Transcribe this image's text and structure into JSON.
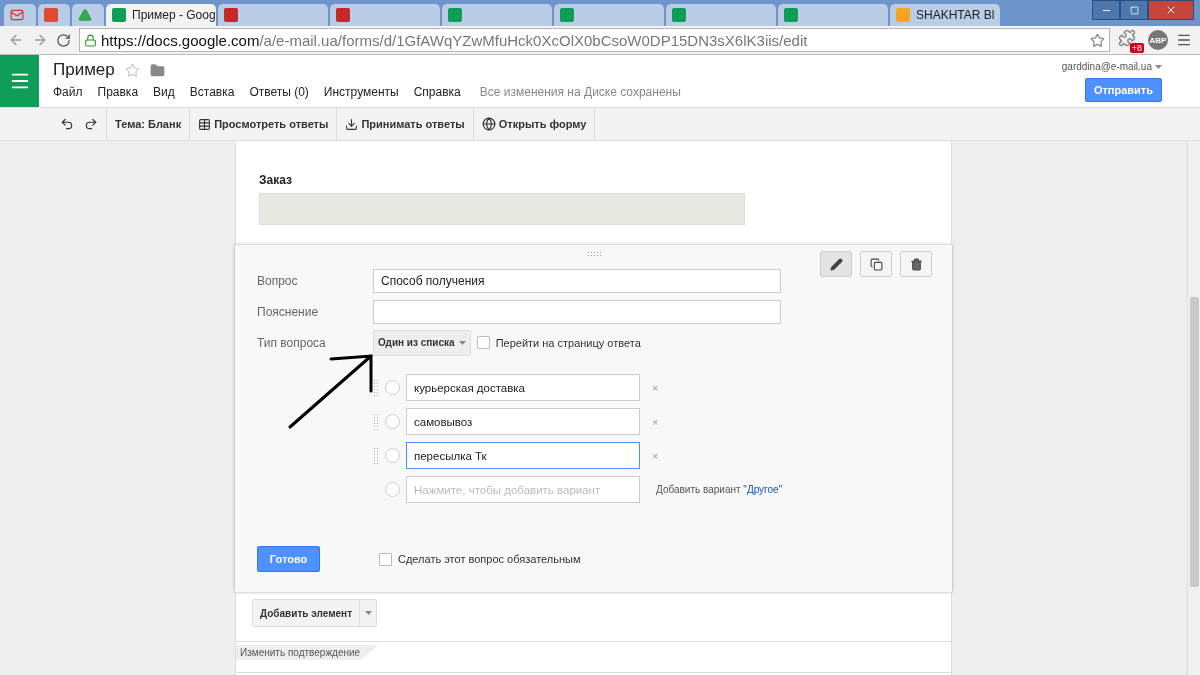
{
  "browser": {
    "tabs": [
      {
        "kind": "gmail",
        "selected": false,
        "color": "#d93025"
      },
      {
        "kind": "app",
        "selected": false,
        "color": "#e04a2f"
      },
      {
        "kind": "drive",
        "selected": false,
        "color": "#34a853"
      },
      {
        "kind": "forms",
        "title": "Пример - Goog",
        "selected": true,
        "color": "#0f9d58"
      },
      {
        "kind": "app",
        "selected": false,
        "color": "#c62828"
      },
      {
        "kind": "app",
        "selected": false,
        "color": "#c62828"
      },
      {
        "kind": "forms",
        "selected": false,
        "color": "#0f9d58"
      },
      {
        "kind": "forms",
        "selected": false,
        "color": "#0f9d58"
      },
      {
        "kind": "forms",
        "selected": false,
        "color": "#0f9d58"
      },
      {
        "kind": "forms",
        "selected": false,
        "color": "#0f9d58"
      },
      {
        "kind": "app",
        "title": "SHAKHTAR Bl",
        "selected": false,
        "color": "#f5a623"
      }
    ],
    "url": {
      "host": "https://docs.google.com",
      "path": "/a/e-mail.ua/forms/d/1GfAWqYZwMfuHck0XcOlX0bCsoW0DP15DN3sX6lK3iis/edit"
    },
    "extension_badge": "+8",
    "extension_label": "ABP"
  },
  "doc": {
    "title": "Пример",
    "menu": [
      "Файл",
      "Правка",
      "Вид",
      "Вставка",
      "Ответы (0)",
      "Инструменты",
      "Справка"
    ],
    "save_status": "Все изменения на Диске сохранены",
    "account": "garddina@e-mail.ua",
    "send_button": "Отправить"
  },
  "toolbar": [
    {
      "kind": "undo"
    },
    {
      "kind": "redo"
    },
    {
      "kind": "theme",
      "label": "Тема: Бланк"
    },
    {
      "kind": "view",
      "label": "Просмотреть ответы"
    },
    {
      "kind": "accept",
      "label": "Принимать ответы"
    },
    {
      "kind": "open",
      "label": "Открыть форму"
    }
  ],
  "form": {
    "previous_item": {
      "title": "Заказ"
    },
    "editor": {
      "fields": [
        {
          "label": "Вопрос",
          "value": "Способ получения"
        },
        {
          "label": "Пояснение"
        }
      ],
      "type_label": "Тип вопроса",
      "type_value": "Один из списка",
      "go_to_page": {
        "label": "Перейти на страницу ответа",
        "checked": false
      },
      "options": [
        {
          "value": "курьерская доставка",
          "focused": false
        },
        {
          "value": "самовывоз",
          "focused": false
        },
        {
          "value": "пересылка Тк",
          "focused": true
        }
      ],
      "add_option_placeholder": "Нажмите, чтобы добавить вариант",
      "other_prefix": "Добавить вариант",
      "other_link": "\"Другое\"",
      "remove_mark": "×",
      "done_button": "Готово",
      "required": {
        "label": "Сделать этот вопрос обязательным",
        "checked": false
      }
    },
    "add_item_button": "Добавить элемент",
    "confirmation_tab": "Изменить подтверждение"
  }
}
